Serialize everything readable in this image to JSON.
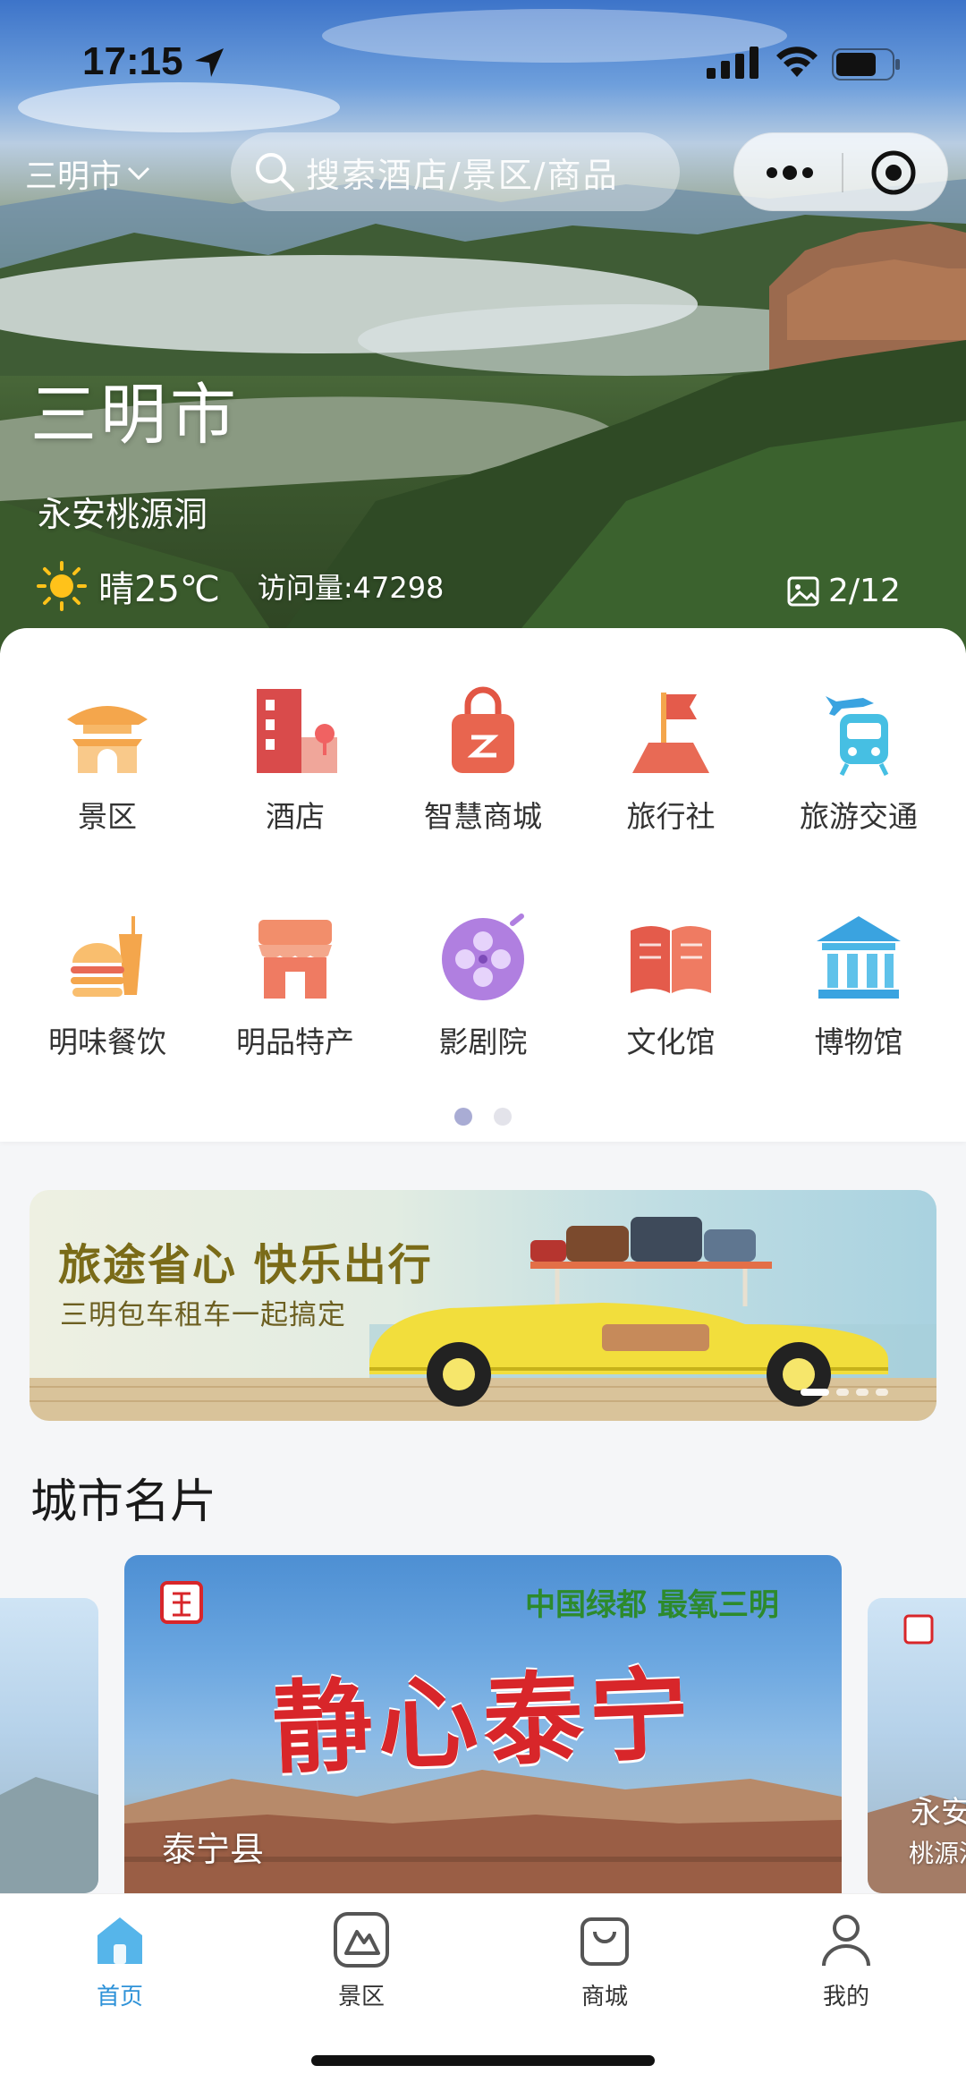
{
  "status_bar": {
    "time": "17:15"
  },
  "nav": {
    "city": "三明市",
    "search_placeholder": "搜索酒店/景区/商品"
  },
  "hero": {
    "city": "三明市",
    "spot": "永安桃源洞",
    "temperature": "晴25℃",
    "visits": "访问量:47298",
    "photo_index": "2/12"
  },
  "categories": [
    {
      "label": "景区",
      "icon": "pavilion-icon"
    },
    {
      "label": "酒店",
      "icon": "hotel-building-icon"
    },
    {
      "label": "智慧商城",
      "icon": "shopping-bag-icon"
    },
    {
      "label": "旅行社",
      "icon": "flag-icon"
    },
    {
      "label": "旅游交通",
      "icon": "plane-train-icon"
    },
    {
      "label": "明味餐饮",
      "icon": "burger-drink-icon"
    },
    {
      "label": "明品特产",
      "icon": "storefront-icon"
    },
    {
      "label": "影剧院",
      "icon": "film-reel-icon"
    },
    {
      "label": "文化馆",
      "icon": "open-book-icon"
    },
    {
      "label": "博物馆",
      "icon": "museum-icon"
    }
  ],
  "grid_pages": {
    "total": 2,
    "active": 1
  },
  "banner": {
    "title": "旅途省心 快乐出行",
    "subtitle": "三明包车租车一起搞定"
  },
  "city_cards": {
    "title": "城市名片",
    "main": {
      "slogan": "静心泰宁",
      "tagline": "中国绿都 最氧三明",
      "caption": "泰宁县"
    },
    "right": {
      "caption": "永安",
      "subcaption": "桃源洞"
    }
  },
  "tabbar": [
    {
      "label": "首页",
      "active": true
    },
    {
      "label": "景区",
      "active": false
    },
    {
      "label": "商城",
      "active": false
    },
    {
      "label": "我的",
      "active": false
    }
  ],
  "colors": {
    "accent_blue": "#2e92d8",
    "banner_title": "#7a6b18",
    "slogan_red": "#d8262a"
  }
}
